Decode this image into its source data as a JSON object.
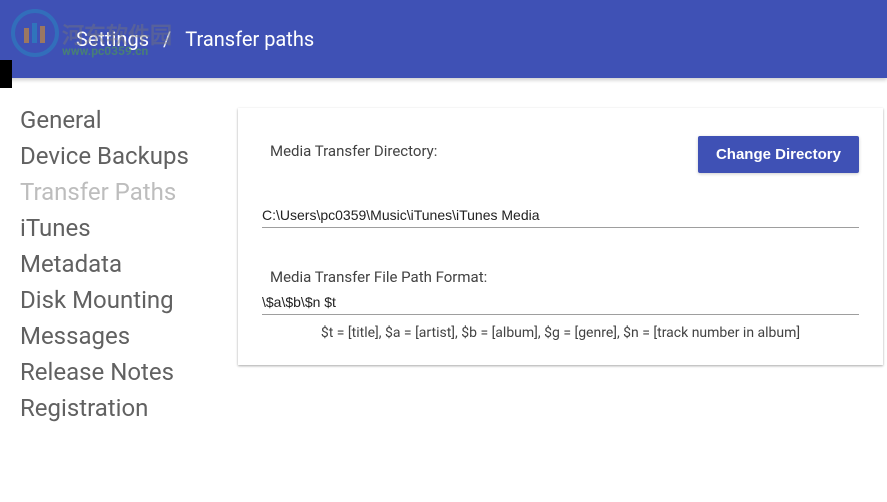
{
  "watermark": {
    "text": "河东软件园",
    "url": "www.pc0359.cn"
  },
  "header": {
    "breadcrumb": {
      "root": "Settings",
      "separator": "/",
      "current": "Transfer paths"
    }
  },
  "sidebar": {
    "items": [
      {
        "label": "General",
        "active": false
      },
      {
        "label": "Device Backups",
        "active": false
      },
      {
        "label": "Transfer Paths",
        "active": true
      },
      {
        "label": "iTunes",
        "active": false
      },
      {
        "label": "Metadata",
        "active": false
      },
      {
        "label": "Disk Mounting",
        "active": false
      },
      {
        "label": "Messages",
        "active": false
      },
      {
        "label": "Release Notes",
        "active": false
      },
      {
        "label": "Registration",
        "active": false
      }
    ]
  },
  "content": {
    "directory_label": "Media Transfer Directory:",
    "change_button": "Change Directory",
    "directory_value": "C:\\Users\\pc0359\\Music\\iTunes\\iTunes Media",
    "format_label": "Media Transfer File Path Format:",
    "format_value": "\\$a\\$b\\$n $t",
    "helper": "$t = [title], $a = [artist], $b = [album], $g = [genre], $n = [track number in album]"
  }
}
